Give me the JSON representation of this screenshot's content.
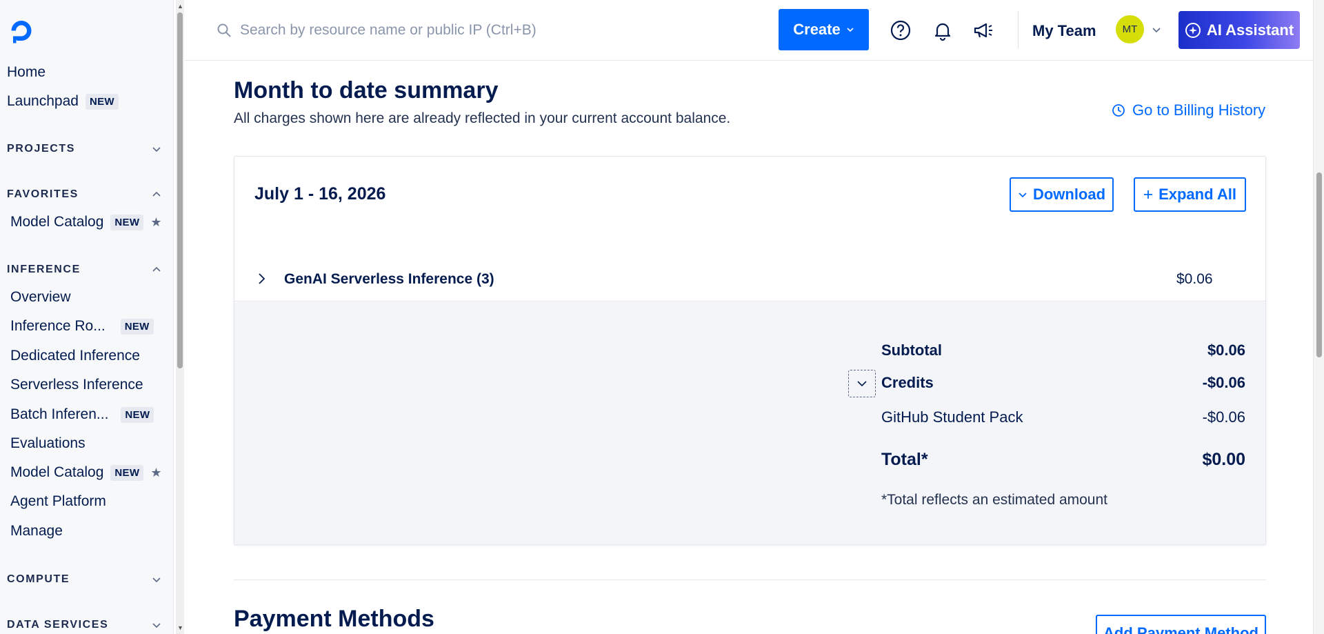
{
  "sidebar": {
    "logo_icon": "digitalocean-logo-icon",
    "home": "Home",
    "launchpad": "Launchpad",
    "new_badge": "NEW",
    "sections": {
      "projects": "PROJECTS",
      "favorites": "FAVORITES",
      "inference": "INFERENCE",
      "compute": "COMPUTE",
      "data_services": "DATA SERVICES"
    },
    "favorites_items": [
      {
        "label": "Model Catalog",
        "badge": "NEW",
        "starred": true
      }
    ],
    "inference_items": [
      {
        "label": "Overview"
      },
      {
        "label": "Inference Ro...",
        "badge": "NEW"
      },
      {
        "label": "Dedicated Inference"
      },
      {
        "label": "Serverless Inference"
      },
      {
        "label": "Batch Inferen...",
        "badge": "NEW"
      },
      {
        "label": "Evaluations"
      },
      {
        "label": "Model Catalog",
        "badge": "NEW",
        "starred": true
      },
      {
        "label": "Agent Platform"
      },
      {
        "label": "Manage"
      }
    ]
  },
  "topbar": {
    "search_placeholder": "Search by resource name or public IP (Ctrl+B)",
    "create_label": "Create",
    "icons": [
      "help-icon",
      "bell-icon",
      "megaphone-icon"
    ],
    "team_name": "My Team",
    "avatar_initials": "MT",
    "ai_assistant_label": "AI Assistant"
  },
  "main": {
    "title": "Month to date summary",
    "subtitle": "All charges shown here are already reflected in your current account balance.",
    "billing_history_link": "Go to Billing History",
    "card": {
      "period": "July 1 - 16, 2026",
      "download_label": "Download",
      "expand_all_label": "Expand All",
      "line_items": [
        {
          "name": "GenAI Serverless Inference (3)",
          "amount": "$0.06"
        }
      ],
      "summary": {
        "subtotal_label": "Subtotal",
        "subtotal_value": "$0.06",
        "credits_label": "Credits",
        "credits_value": "-$0.06",
        "credit_items": [
          {
            "name": "GitHub Student Pack",
            "amount": "-$0.06"
          }
        ],
        "total_label": "Total*",
        "total_value": "$0.00",
        "note": "*Total reflects an estimated amount"
      }
    },
    "payment_methods_title": "Payment Methods",
    "add_payment_method_label": "Add Payment Method"
  },
  "colors": {
    "accent": "#0069ff",
    "text": "#031b4e",
    "avatar": "#d6de0a",
    "summary_bg": "#f3f5f9"
  }
}
